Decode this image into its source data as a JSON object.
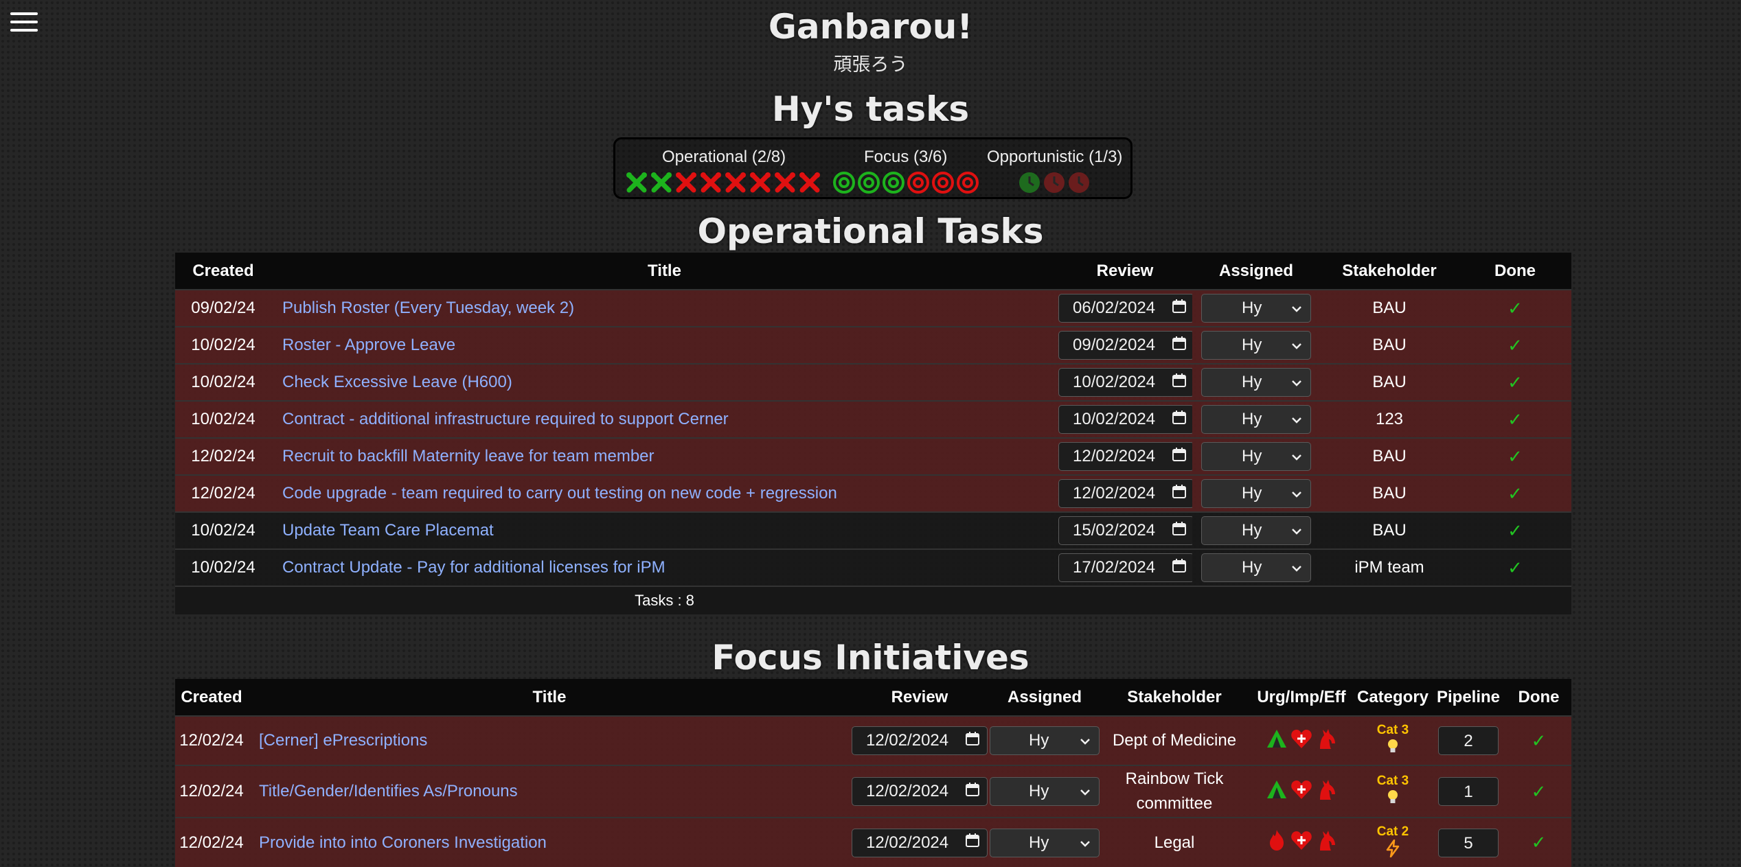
{
  "app": {
    "title": "Ganbarou!",
    "subtitle": "頑張ろう",
    "user_heading": "Hy's tasks"
  },
  "summary": {
    "operational_label": "Operational (2/8)",
    "focus_label": "Focus (3/6)",
    "opportunistic_label": "Opportunistic (1/3)",
    "operational_done": 2,
    "operational_total": 8,
    "focus_done": 3,
    "focus_total": 6,
    "opportunistic_done": 1,
    "opportunistic_total": 3
  },
  "colors": {
    "done_green": "#1db31d",
    "pending_red": "#e01010",
    "link_blue": "#8fb1ff",
    "category_yellow": "#ffc400"
  },
  "operational": {
    "heading": "Operational Tasks",
    "headers": [
      "Created",
      "Title",
      "Review",
      "Assigned",
      "Stakeholder",
      "Done"
    ],
    "rows": [
      {
        "created": "09/02/24",
        "title": "Publish Roster (Every Tuesday, week 2)",
        "review": "06/02/2024",
        "assigned": "Hy",
        "stakeholder": "BAU",
        "done_icon": "check-icon"
      },
      {
        "created": "10/02/24",
        "title": "Roster - Approve Leave",
        "review": "09/02/2024",
        "assigned": "Hy",
        "stakeholder": "BAU",
        "done_icon": "check-icon"
      },
      {
        "created": "10/02/24",
        "title": "Check Excessive Leave (H600)",
        "review": "10/02/2024",
        "assigned": "Hy",
        "stakeholder": "BAU",
        "done_icon": "check-icon"
      },
      {
        "created": "10/02/24",
        "title": "Contract - additional infrastructure required to support Cerner",
        "review": "10/02/2024",
        "assigned": "Hy",
        "stakeholder": "123",
        "done_icon": "check-icon"
      },
      {
        "created": "12/02/24",
        "title": "Recruit to backfill Maternity leave for team member",
        "review": "12/02/2024",
        "assigned": "Hy",
        "stakeholder": "BAU",
        "done_icon": "check-icon"
      },
      {
        "created": "12/02/24",
        "title": "Code upgrade - team required to carry out testing on new code + regression",
        "review": "12/02/2024",
        "assigned": "Hy",
        "stakeholder": "BAU",
        "done_icon": "check-icon"
      },
      {
        "created": "10/02/24",
        "title": "Update Team Care Placemat",
        "review": "15/02/2024",
        "assigned": "Hy",
        "stakeholder": "BAU",
        "done_icon": "check-icon"
      },
      {
        "created": "10/02/24",
        "title": "Contract Update - Pay for additional licenses for iPM",
        "review": "17/02/2024",
        "assigned": "Hy",
        "stakeholder": "iPM team",
        "done_icon": "check-icon"
      }
    ],
    "footer": "Tasks : 8"
  },
  "focus": {
    "heading": "Focus Initiatives",
    "headers": [
      "Created",
      "Title",
      "Review",
      "Assigned",
      "Stakeholder",
      "Urg/Imp/Eff",
      "Category",
      "Pipeline",
      "Done"
    ],
    "rows": [
      {
        "created": "12/02/24",
        "title": "[Cerner] ePrescriptions",
        "review": "12/02/2024",
        "assigned": "Hy",
        "stakeholder_line1": "Dept of Medicine",
        "stakeholder_line2": "",
        "urgency": "low",
        "category": "Cat 3",
        "category_icon": "lightbulb-icon",
        "pipeline": "2",
        "done_icon": "check-icon"
      },
      {
        "created": "12/02/24",
        "title": "Title/Gender/Identifies As/Pronouns",
        "review": "12/02/2024",
        "assigned": "Hy",
        "stakeholder_line1": "Rainbow Tick",
        "stakeholder_line2": "committee",
        "urgency": "low",
        "category": "Cat 3",
        "category_icon": "lightbulb-icon",
        "pipeline": "1",
        "done_icon": "check-icon"
      },
      {
        "created": "12/02/24",
        "title": "Provide into into Coroners Investigation",
        "review": "12/02/2024",
        "assigned": "Hy",
        "stakeholder_line1": "Legal",
        "stakeholder_line2": "",
        "urgency": "high",
        "category": "Cat 2",
        "category_icon": "lightning-icon",
        "pipeline": "5",
        "done_icon": "check-icon"
      }
    ]
  }
}
